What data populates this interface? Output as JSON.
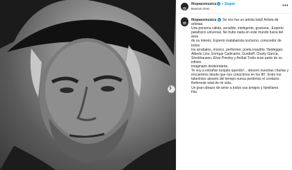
{
  "post": {
    "account": {
      "username": "fitopaezmusica",
      "verified": true,
      "follow_label": "Seguir",
      "location": "Buenos Aires",
      "more_icon": "more-options-icon"
    },
    "photo": {
      "description_icon": "portrait-photo",
      "next_icon": "chevron-right-icon"
    },
    "caption": {
      "username": "fitopaezmusica",
      "lines": [
        "Se nos fue un artista total! Artista de artistas.",
        "Una persona cálida, sensible, inteligente, graciosa...Experto",
        "patafísico universal. No hubo nada en este mundo fuera del área",
        "de su interés. Experto malabarista nocturno, conocedor de todos",
        "los arrabales, músico, performer, poeta inaudito. Heidegger,",
        "Alberto Lins, Enrique Cadicamo, Gurdieff, Charly García,",
        "Stockhausen, Elvis Presley y Aníbal Troilo eran parte de su infinito",
        "imaginario desbordante.",
        "Te voy a extrañar turquito querido!... atesoro nuestras charlas y",
        "encuentros desde que nos conocimos en los 80'. Entre los",
        "laberintos através del tiempo nunca perdimos el contacto.",
        "Referente total de mi vida.",
        "Un gran abrazo de amor a todos sus amigos y familiares",
        "Fito"
      ]
    }
  }
}
